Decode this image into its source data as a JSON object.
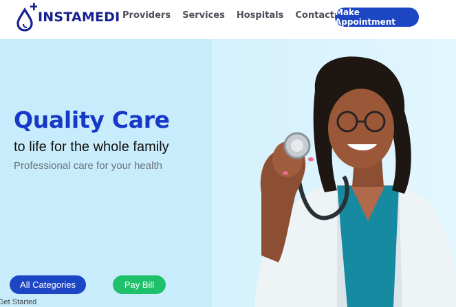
{
  "header": {
    "logo_text": "INSTAMEDI",
    "nav": [
      "Providers",
      "Services",
      "Hospitals",
      "Contacts"
    ],
    "cta_label": "Make Appointment"
  },
  "hero": {
    "title": "Quality Care",
    "subtitle": "to life for the whole family",
    "tagline": "Professional care for your health",
    "categories_button": "All Categories",
    "pay_button": "Pay Bill",
    "get_started": "Get Started",
    "image_icon": "doctor-with-stethoscope-photo"
  },
  "colors": {
    "brand_blue": "#1d46c4",
    "title_blue": "#1739c8",
    "green": "#1fc06a",
    "hero_bg": "#c8ecfb"
  }
}
